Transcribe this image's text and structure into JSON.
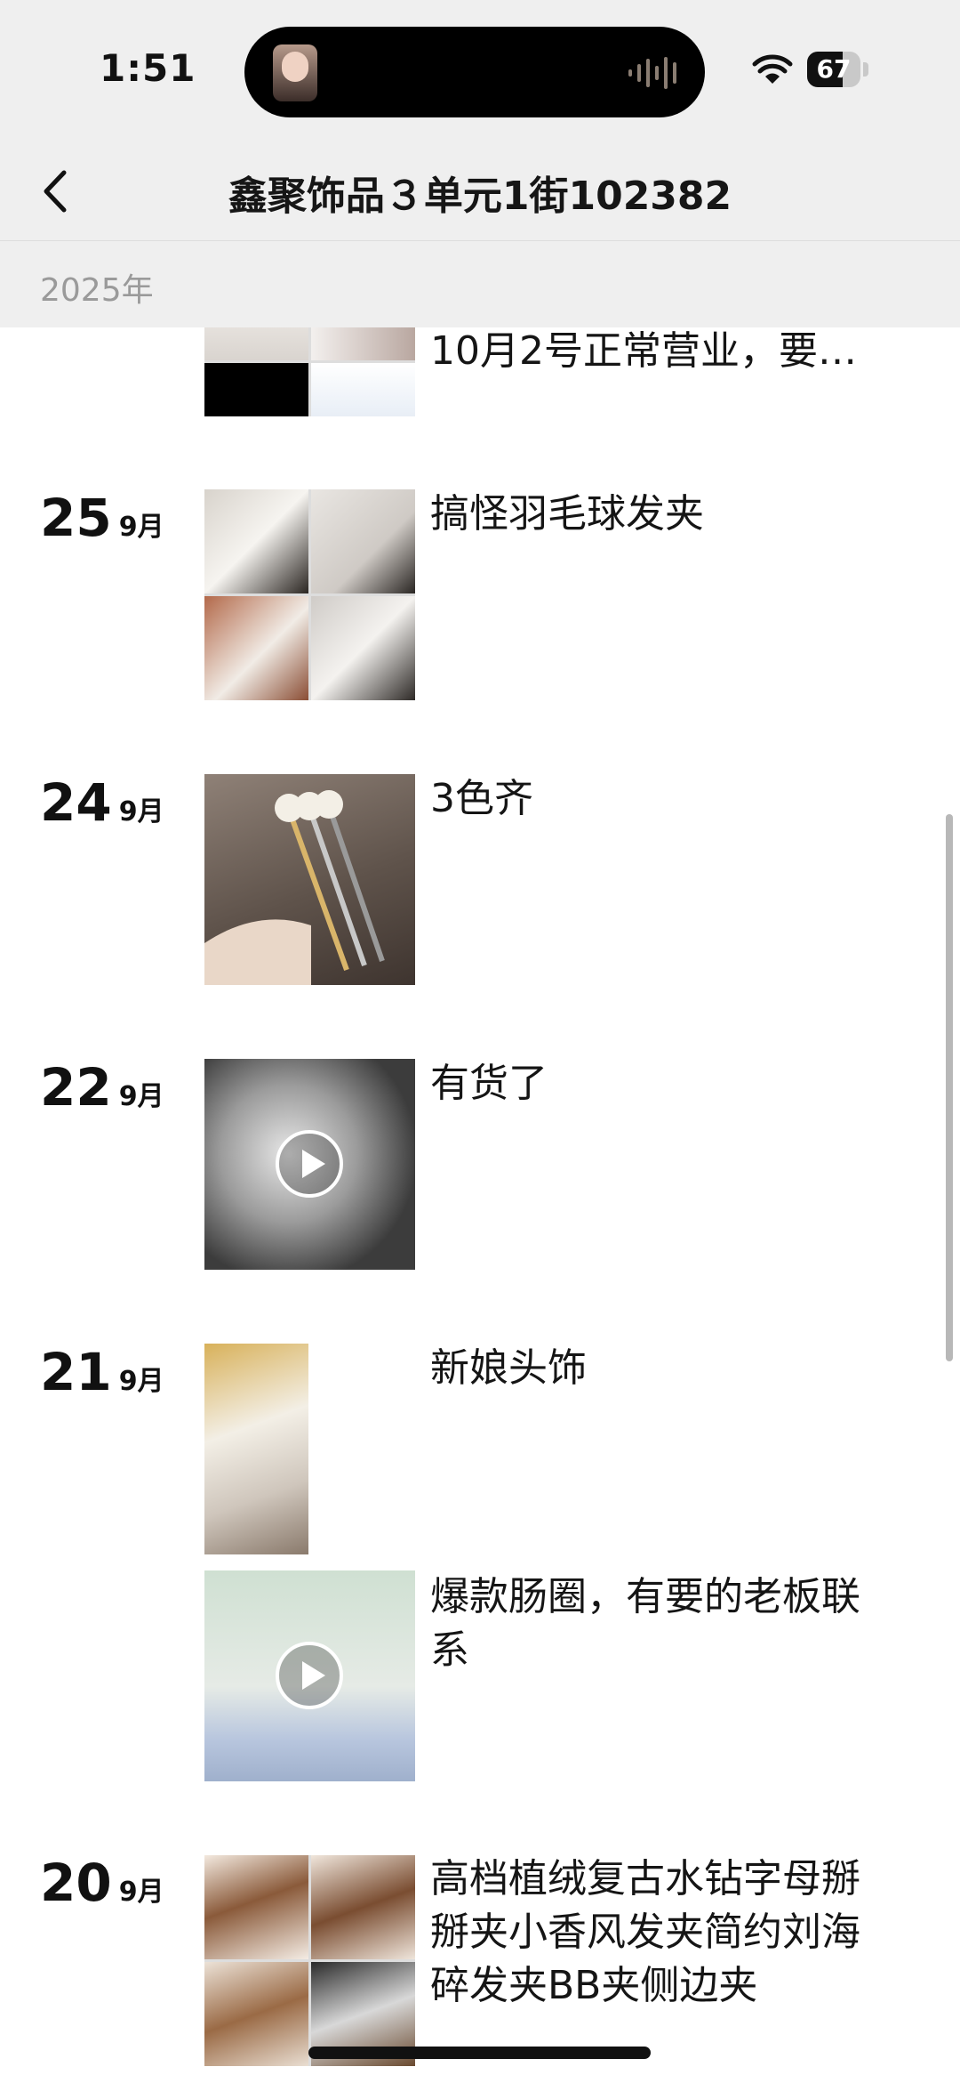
{
  "status_bar": {
    "time": "1:51",
    "battery": "67",
    "battery_level": 0.67
  },
  "nav": {
    "title": "鑫聚饰品３单元1街102382"
  },
  "year_header": "2025年",
  "posts": [
    {
      "text": "10月2号正常营业，要…"
    },
    {
      "day": "25",
      "month": "9月",
      "text": "搞怪羽毛球发夹"
    },
    {
      "day": "24",
      "month": "9月",
      "text": "3色齐"
    },
    {
      "day": "22",
      "month": "9月",
      "text": "有货了"
    },
    {
      "day": "21",
      "month": "9月",
      "text": "新娘头饰"
    },
    {
      "text": "爆款肠圈，有要的老板联系"
    },
    {
      "day": "20",
      "month": "9月",
      "text": "高档植绒复古水钻字母掰掰夹小香风发夹简约刘海碎发夹BB夹侧边夹"
    }
  ],
  "icons": {
    "back": "chevron-left-icon",
    "play": "play-icon",
    "wifi": "wifi-icon",
    "battery": "battery-icon"
  }
}
